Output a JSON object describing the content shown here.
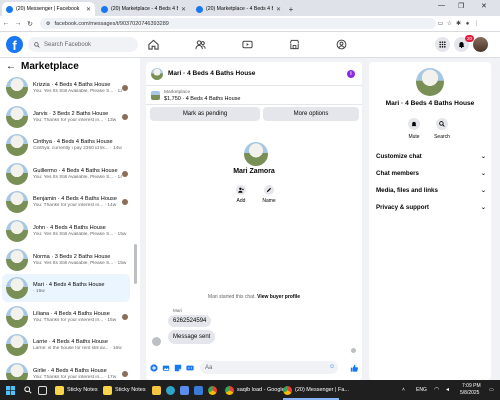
{
  "browser": {
    "tabs": [
      {
        "title": "(20) Messenger | Facebook"
      },
      {
        "title": "(20) Marketplace - 4 Beds 4 Ba..."
      },
      {
        "title": "(20) Marketplace - 4 Beds 4 Ba..."
      }
    ],
    "new_tab": "+",
    "minimize": "—",
    "maximize": "❐",
    "close": "✕",
    "url": "facebook.com/messages/t/9037020746393289"
  },
  "header": {
    "logo": "f",
    "search_placeholder": "Search Facebook",
    "notification_count": "20"
  },
  "marketplace": {
    "title": "Marketplace",
    "conversations": [
      {
        "title": "Krizzia · 4 Beds 4 Baths House",
        "sub": "You: Yes Its Still Available, Please S... · 12w",
        "seen": true
      },
      {
        "title": "Jarvis · 3 Beds 2 Baths House",
        "sub": "You: Thanks for your interest in... · 13w",
        "seen": true
      },
      {
        "title": "Cinthya · 4 Beds 4 Baths House",
        "sub": "Cinthya: currently i pay 2350 id lik... · 14w",
        "seen": false
      },
      {
        "title": "Guillermo · 4 Beds 4 Baths House",
        "sub": "You: Yes Its Still Available, Please S... · 14w",
        "seen": true
      },
      {
        "title": "Benjamin · 4 Beds 4 Baths House",
        "sub": "You: Thanks for your interest in... · 14w",
        "seen": true
      },
      {
        "title": "John · 4 Beds 4 Baths House",
        "sub": "You: Yes Its Still Available, Please S... · 15w",
        "seen": false
      },
      {
        "title": "Norma · 3 Beds 2 Baths House",
        "sub": "You: Yes Its Still Available, Please S... · 15w",
        "seen": false
      },
      {
        "title": "Mari · 4 Beds 4 Baths House",
        "sub": "· 15w",
        "seen": false
      },
      {
        "title": "Liliana · 4 Beds 4 Baths House",
        "sub": "You: Thanks for your interest in... · 15w",
        "seen": true
      },
      {
        "title": "Larrie · 4 Beds 4 Baths House",
        "sub": "Larrie: is the house for rent still av... · 16w",
        "seen": false
      },
      {
        "title": "Girlie · 4 Beds 4 Baths House",
        "sub": "You: Thanks for your interest in... · 17w",
        "seen": true
      }
    ]
  },
  "chat": {
    "title": "Mari · 4 Beds 4 Baths House",
    "listing_label": "Marketplace",
    "listing_text": "$1,750 · 4 Beds 4 Baths House",
    "mark_pending": "Mark as pending",
    "more_options": "More options",
    "profile_name": "Mari Zamora",
    "add_label": "Add",
    "name_label": "Name",
    "system_msg": "Mari started this chat.",
    "view_profile": "View buyer profile",
    "sender": "Mari",
    "msg1": "6262524594",
    "msg2": "Message sent",
    "input_placeholder": "Aa"
  },
  "details": {
    "title": "Mari · 4 Beds 4 Baths House",
    "mute": "Mute",
    "search": "Search",
    "rows": [
      "Customize chat",
      "Chat members",
      "Media, files and links",
      "Privacy & support"
    ]
  },
  "taskbar": {
    "items": [
      "Sticky Notes",
      "Sticky Notes",
      "saqib load - Google...",
      "(20) Messenger | Fa..."
    ],
    "lang": "ENG",
    "time": "7:09 PM",
    "date": "5/8/2025"
  }
}
